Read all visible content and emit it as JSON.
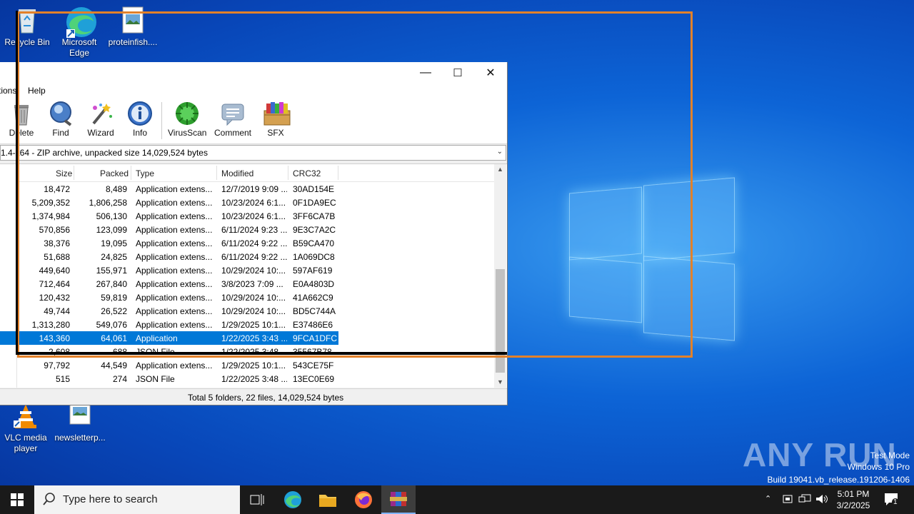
{
  "desktop": {
    "icons": [
      {
        "label": "Recycle Bin"
      },
      {
        "label": "Microsoft Edge"
      },
      {
        "label": "proteinfish...."
      },
      {
        "label": "VLC media player"
      },
      {
        "label": "newsletterp..."
      }
    ]
  },
  "window": {
    "minimize": "—",
    "maximize": "☐",
    "close": "✕",
    "menu": {
      "partial_item": "tions",
      "help": "Help"
    },
    "toolbar": [
      {
        "label": "Delete",
        "icon": "trash-icon"
      },
      {
        "label": "Find",
        "icon": "magnifier-icon"
      },
      {
        "label": "Wizard",
        "icon": "wand-icon"
      },
      {
        "label": "Info",
        "icon": "info-icon"
      },
      {
        "label": "VirusScan",
        "icon": "virus-scan-icon"
      },
      {
        "label": "Comment",
        "icon": "comment-icon"
      },
      {
        "label": "SFX",
        "icon": "sfx-box-icon"
      }
    ],
    "address": "1.4-x64 - ZIP archive, unpacked size 14,029,524 bytes",
    "columns": {
      "size": "Size",
      "packed": "Packed",
      "type": "Type",
      "modified": "Modified",
      "crc": "CRC32"
    },
    "rows": [
      {
        "size": "18,472",
        "packed": "8,489",
        "type": "Application extens...",
        "modified": "12/7/2019 9:09 ...",
        "crc": "30AD154E"
      },
      {
        "size": "5,209,352",
        "packed": "1,806,258",
        "type": "Application extens...",
        "modified": "10/23/2024 6:1...",
        "crc": "0F1DA9EC"
      },
      {
        "size": "1,374,984",
        "packed": "506,130",
        "type": "Application extens...",
        "modified": "10/23/2024 6:1...",
        "crc": "3FF6CA7B"
      },
      {
        "size": "570,856",
        "packed": "123,099",
        "type": "Application extens...",
        "modified": "6/11/2024 9:23 ...",
        "crc": "9E3C7A2C"
      },
      {
        "size": "38,376",
        "packed": "19,095",
        "type": "Application extens...",
        "modified": "6/11/2024 9:22 ...",
        "crc": "B59CA470"
      },
      {
        "size": "51,688",
        "packed": "24,825",
        "type": "Application extens...",
        "modified": "6/11/2024 9:22 ...",
        "crc": "1A069DC8"
      },
      {
        "size": "449,640",
        "packed": "155,971",
        "type": "Application extens...",
        "modified": "10/29/2024 10:...",
        "crc": "597AF619"
      },
      {
        "size": "712,464",
        "packed": "267,840",
        "type": "Application extens...",
        "modified": "3/8/2023 7:09 ...",
        "crc": "E0A4803D"
      },
      {
        "size": "120,432",
        "packed": "59,819",
        "type": "Application extens...",
        "modified": "10/29/2024 10:...",
        "crc": "41A662C9"
      },
      {
        "size": "49,744",
        "packed": "26,522",
        "type": "Application extens...",
        "modified": "10/29/2024 10:...",
        "crc": "BD5C744A"
      },
      {
        "size": "1,313,280",
        "packed": "549,076",
        "type": "Application extens...",
        "modified": "1/29/2025 10:1...",
        "crc": "E37486E6"
      },
      {
        "size": "143,360",
        "packed": "64,061",
        "type": "Application",
        "modified": "1/22/2025 3:43 ...",
        "crc": "9FCA1DFC",
        "selected": true
      },
      {
        "size": "2,608",
        "packed": "688",
        "type": "JSON File",
        "modified": "1/22/2025 3:48 ...",
        "crc": "35567B78"
      },
      {
        "size": "97,792",
        "packed": "44,549",
        "type": "Application extens...",
        "modified": "1/29/2025 10:1...",
        "crc": "543CE75F"
      },
      {
        "size": "515",
        "packed": "274",
        "type": "JSON File",
        "modified": "1/22/2025 3:48 ...",
        "crc": "13EC0E69"
      }
    ],
    "status": "Total 5 folders, 22 files, 14,029,524 bytes"
  },
  "watermark": {
    "brand": "ANY RUN",
    "line1": "Test Mode",
    "line2": "Windows 10 Pro",
    "line3": "Build 19041.vb_release.191206-1406"
  },
  "taskbar": {
    "search_placeholder": "Type here to search",
    "time": "5:01 PM",
    "date": "3/2/2025",
    "notification_count": "1"
  }
}
